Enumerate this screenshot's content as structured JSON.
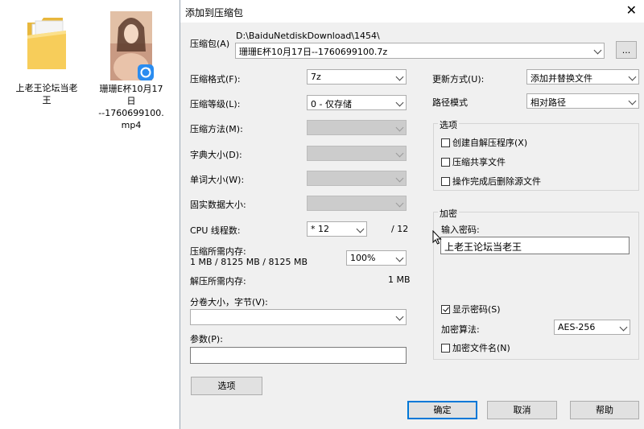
{
  "desktop": {
    "icons": [
      {
        "label_line1": "上老王论坛当老",
        "label_line2": "王",
        "icon": "folder-icon"
      },
      {
        "label_line1": "珊珊E杯10月17",
        "label_line2": "日",
        "label_line3": "--1760699100.",
        "label_line4": "mp4",
        "icon": "video-thumbnail-icon",
        "badge": "sync-badge-icon"
      }
    ]
  },
  "dialog": {
    "title": "添加到压缩包",
    "close_symbol": "✕",
    "archive_label": "压缩包(A)",
    "archive_path": "D:\\BaiduNetdiskDownload\\1454\\",
    "archive_name": "珊珊E杯10月17日--1760699100.7z",
    "browse_label": "...",
    "format_label": "压缩格式(F):",
    "format_value": "7z",
    "level_label": "压缩等级(L):",
    "level_value": "0 - 仅存储",
    "method_label": "压缩方法(M):",
    "dict_label": "字典大小(D):",
    "word_label": "单词大小(W):",
    "solid_label": "固实数据大小:",
    "cpu_label": "CPU 线程数:",
    "cpu_value": "* 12",
    "cpu_total": "/ 12",
    "mem_comp_label": "压缩所需内存:",
    "mem_comp_value": "1 MB / 8125 MB / 8125 MB",
    "mem_percent": "100%",
    "mem_decomp_label": "解压所需内存:",
    "mem_decomp_value": "1 MB",
    "split_label": "分卷大小，字节(V):",
    "params_label": "参数(P):",
    "options_button": "选项",
    "update_label": "更新方式(U):",
    "update_value": "添加并替换文件",
    "path_label": "路径模式",
    "path_value": "相对路径",
    "options_group": "选项",
    "opt_sfx": "创建自解压程序(X)",
    "opt_shared": "压缩共享文件",
    "opt_delete": "操作完成后删除源文件",
    "encrypt_group": "加密",
    "password_label": "输入密码:",
    "password_value": "上老王论坛当老王",
    "show_password": "显示密码(S)",
    "enc_method_label": "加密算法:",
    "enc_method_value": "AES-256",
    "enc_names": "加密文件名(N)",
    "ok_button": "确定",
    "cancel_button": "取消",
    "help_button": "帮助"
  }
}
